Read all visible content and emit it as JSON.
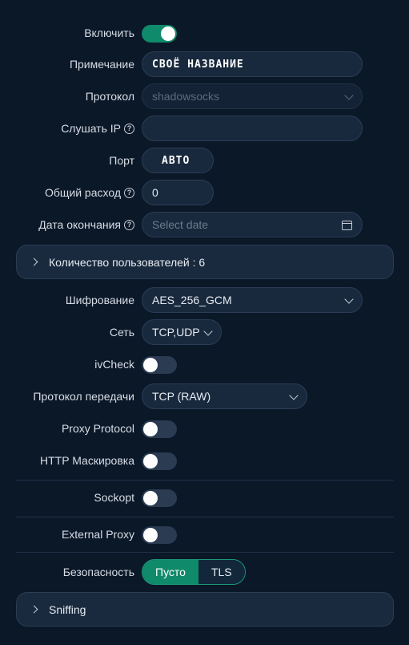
{
  "enable": {
    "label": "Включить",
    "on": true
  },
  "remark": {
    "label": "Примечание",
    "value": "СВОЁ НАЗВАНИЕ"
  },
  "protocol": {
    "label": "Протокол",
    "value": "shadowsocks"
  },
  "listen_ip": {
    "label": "Слушать IP",
    "value": ""
  },
  "port": {
    "label": "Порт",
    "value": "АВТО"
  },
  "total_traffic": {
    "label": "Общий расход",
    "value": "0"
  },
  "expiry": {
    "label": "Дата окончания",
    "placeholder": "Select date"
  },
  "clients_section": {
    "label": "Количество пользователей : 6"
  },
  "encryption": {
    "label": "Шифрование",
    "value": "AES_256_GCM"
  },
  "network": {
    "label": "Сеть",
    "value": "TCP,UDP"
  },
  "ivcheck": {
    "label": "ivCheck",
    "on": false
  },
  "transmission": {
    "label": "Протокол передачи",
    "value": "TCP (RAW)"
  },
  "proxy_protocol": {
    "label": "Proxy Protocol",
    "on": false
  },
  "http_masking": {
    "label": "HTTP Маскировка",
    "on": false
  },
  "sockopt": {
    "label": "Sockopt",
    "on": false
  },
  "external_proxy": {
    "label": "External Proxy",
    "on": false
  },
  "security": {
    "label": "Безопасность",
    "options": [
      "Пусто",
      "TLS"
    ],
    "selected": "Пусто"
  },
  "sniffing_section": {
    "label": "Sniffing"
  },
  "colors": {
    "background": "#0b1828",
    "accent": "#0f8a6a",
    "field": "#19293d"
  }
}
